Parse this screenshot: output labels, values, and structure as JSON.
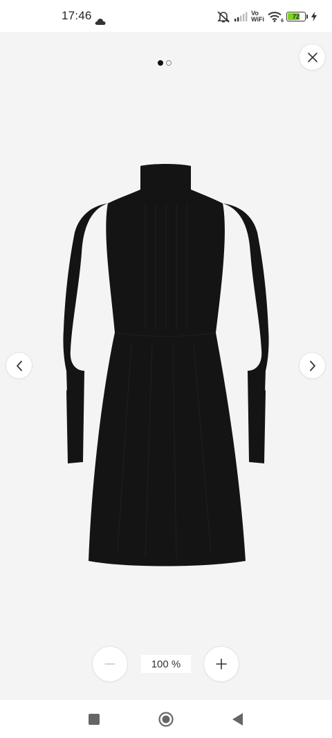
{
  "status_bar": {
    "time": "17:46",
    "vowifi_top": "Vo",
    "vowifi_bottom": "WiFi",
    "wifi_sub": "6",
    "battery_level": "72",
    "battery_fraction": 0.72,
    "battery_color": "#7ed321",
    "icons": [
      "cloud-icon",
      "mute-icon",
      "signal-icon",
      "wifi-icon",
      "battery-icon",
      "charging-icon"
    ]
  },
  "viewer": {
    "pager": {
      "total": 2,
      "active_index": 0
    },
    "close_icon": "close-icon",
    "prev_icon": "chevron-left-icon",
    "next_icon": "chevron-right-icon",
    "image": "black turtleneck knit dress",
    "zoom": {
      "level_label": "100 %",
      "zoom_out_icon": "minus-icon",
      "zoom_in_icon": "plus-icon"
    }
  },
  "nav_bar": {
    "icons": [
      "square-recents-icon",
      "circle-home-icon",
      "triangle-back-icon"
    ]
  },
  "colors": {
    "background": "#f4f4f4",
    "bar_background": "#ffffff",
    "dress": "#141414"
  }
}
